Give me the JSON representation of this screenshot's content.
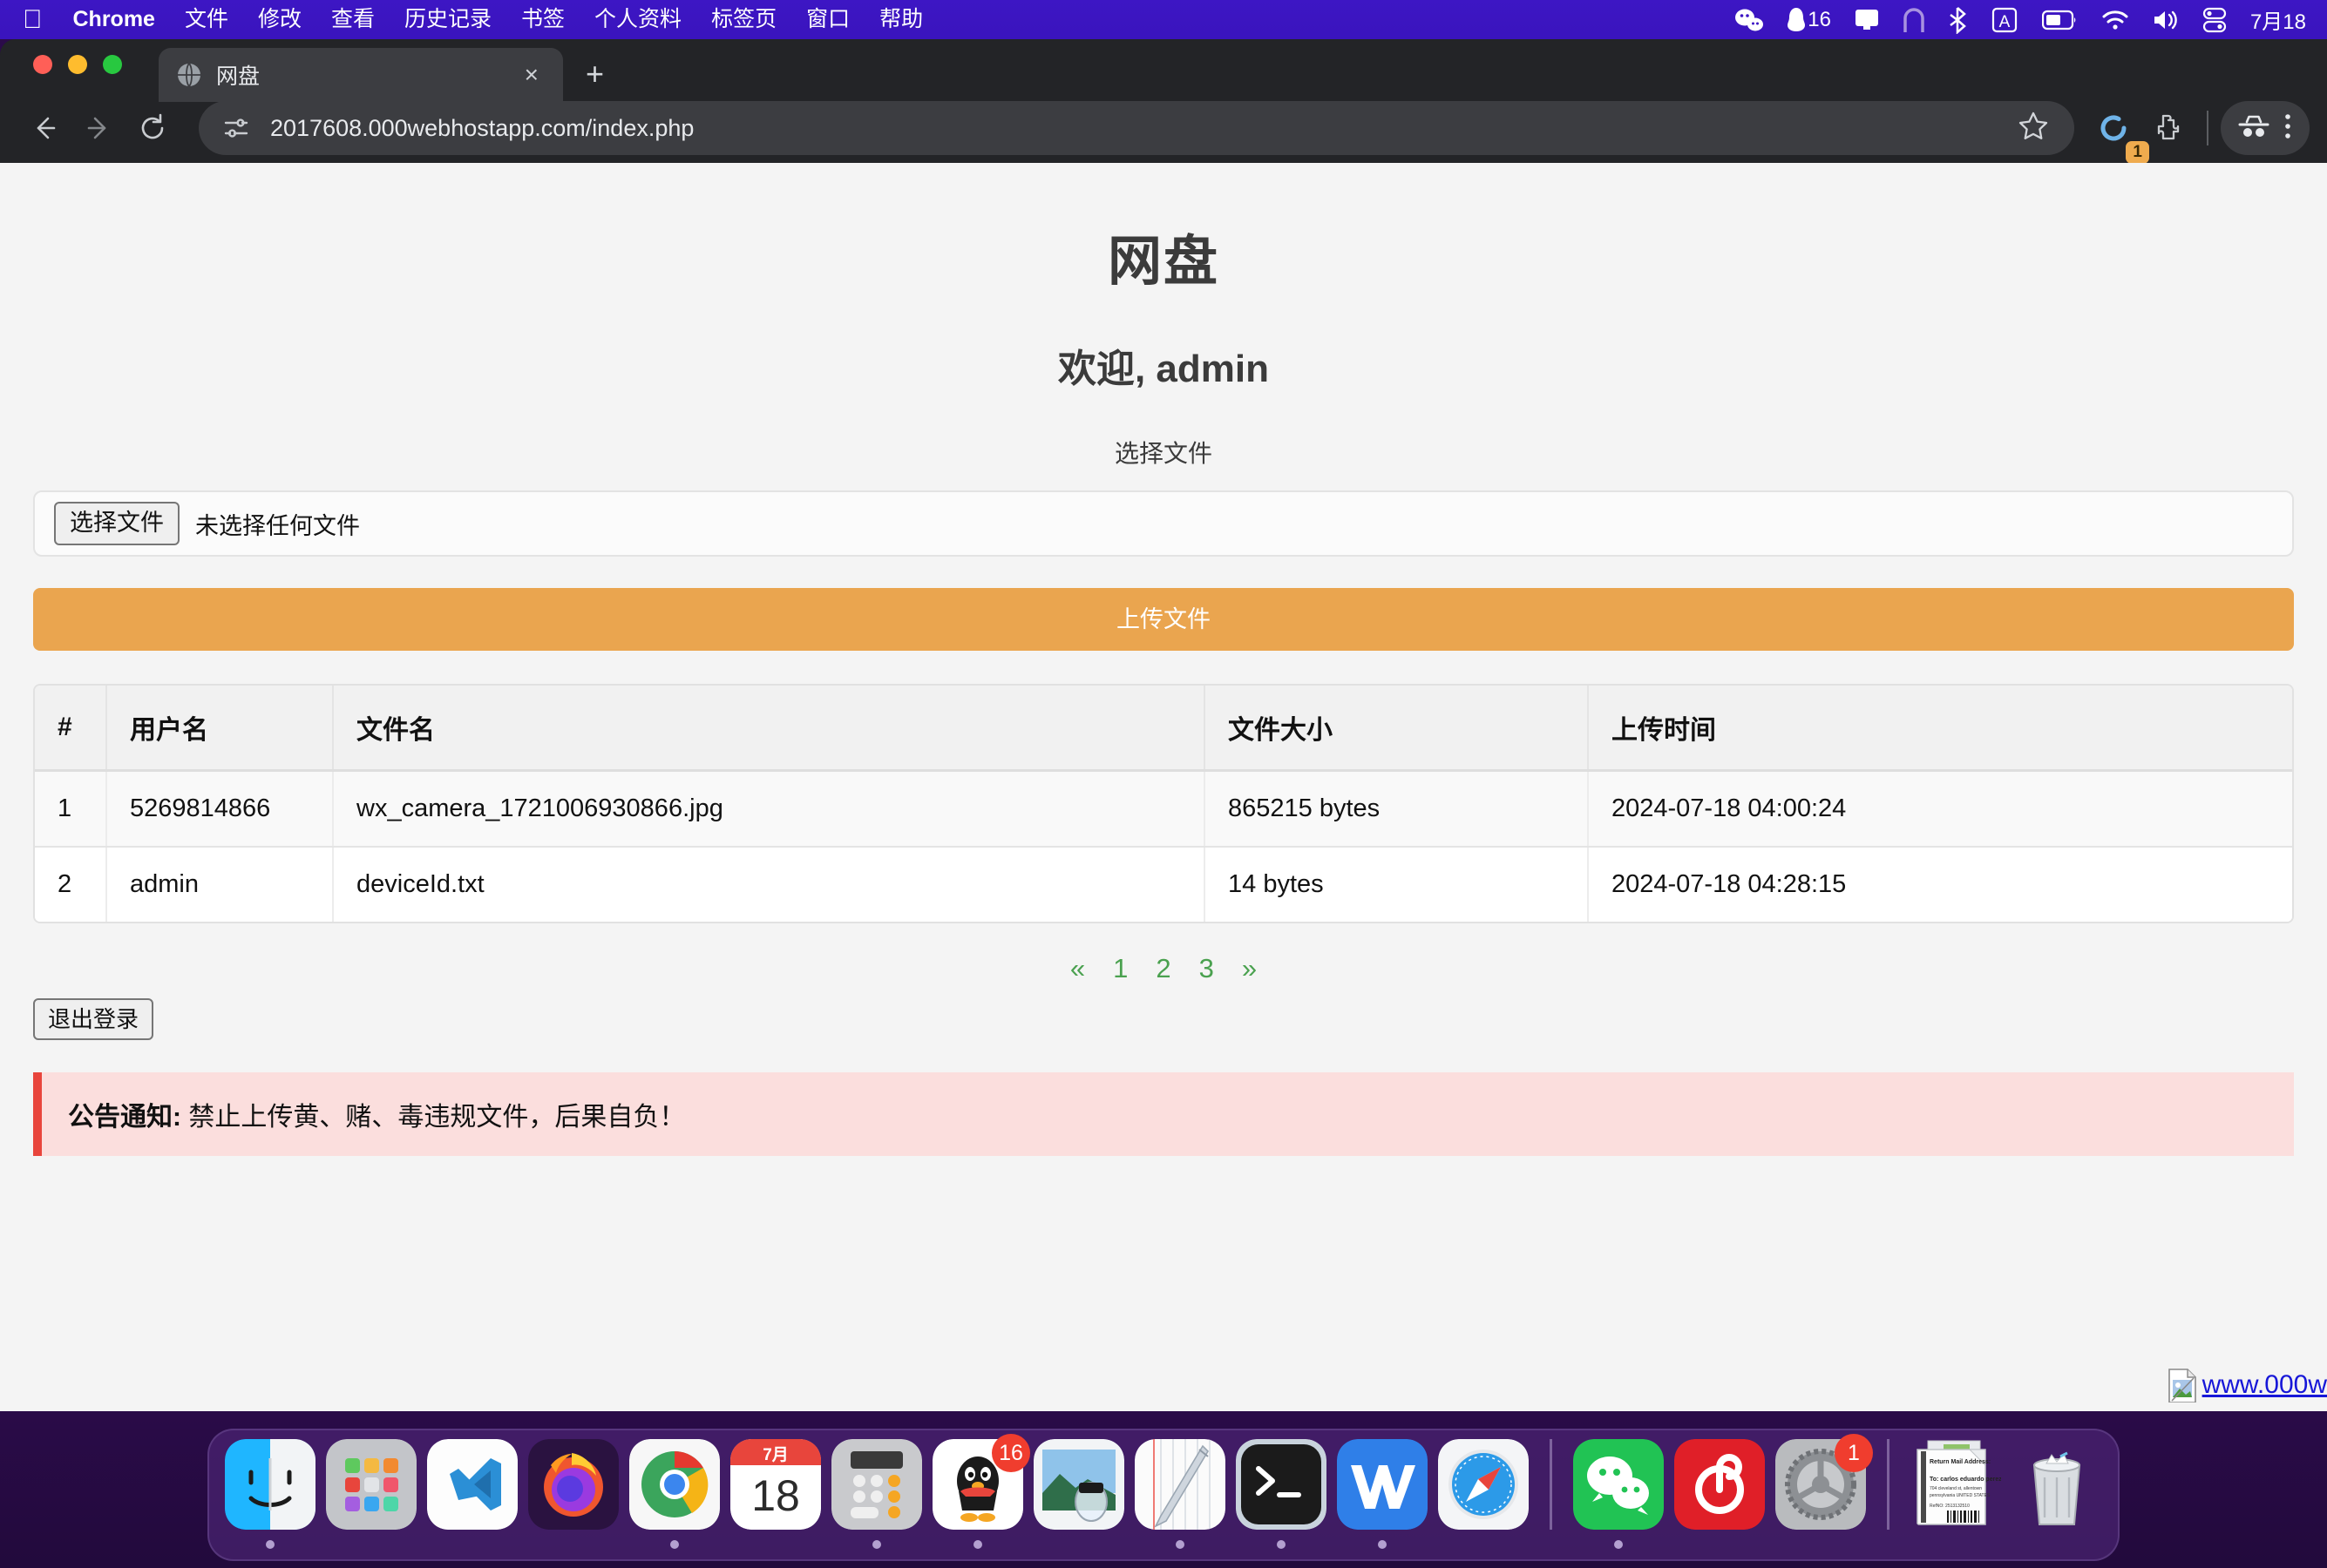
{
  "menubar": {
    "apple_icon": "apple-logo-icon",
    "items": [
      {
        "label": "Chrome",
        "bold": true
      },
      {
        "label": "文件",
        "bold": false
      },
      {
        "label": "修改",
        "bold": false
      },
      {
        "label": "查看",
        "bold": false
      },
      {
        "label": "历史记录",
        "bold": false
      },
      {
        "label": "书签",
        "bold": false
      },
      {
        "label": "个人资料",
        "bold": false
      },
      {
        "label": "标签页",
        "bold": false
      },
      {
        "label": "窗口",
        "bold": false
      },
      {
        "label": "帮助",
        "bold": false
      }
    ],
    "status": {
      "wechat_icon": "wechat-icon",
      "qq_icon": "qq-icon",
      "qq_count": "16",
      "display_icon": "display-icon",
      "arc_icon": "arc-icon",
      "bluetooth_icon": "bluetooth-icon",
      "input_method": "A",
      "battery_icon": "battery-icon",
      "wifi_icon": "wifi-icon",
      "volume_icon": "volume-icon",
      "control_center_icon": "control-center-icon",
      "date": "7月18"
    }
  },
  "browser": {
    "tab": {
      "favicon": "globe-icon",
      "title": "网盘",
      "close": "×"
    },
    "new_tab": "+",
    "toolbar": {
      "back_icon": "back-arrow-icon",
      "forward_icon": "forward-arrow-icon",
      "reload_icon": "reload-icon",
      "site_info_icon": "site-settings-icon",
      "url": "2017608.000webhostapp.com/index.php",
      "bookmark_icon": "star-icon",
      "sync_icon": "sync-circle-icon",
      "sync_badge": "1",
      "extensions_icon": "puzzle-icon",
      "incognito_icon": "incognito-icon",
      "menu_icon": "more-menu-icon"
    }
  },
  "page": {
    "title": "网盘",
    "welcome": "欢迎, admin",
    "pick_label": "选择文件",
    "file_input": {
      "button": "选择文件",
      "status": "未选择任何文件"
    },
    "upload_button": "上传文件",
    "table": {
      "headers": [
        "#",
        "用户名",
        "文件名",
        "文件大小",
        "上传时间"
      ],
      "rows": [
        {
          "index": "1",
          "user": "5269814866",
          "filename": "wx_camera_1721006930866.jpg",
          "size": "865215 bytes",
          "time": "2024-07-18 04:00:24"
        },
        {
          "index": "2",
          "user": "admin",
          "filename": "deviceId.txt",
          "size": "14 bytes",
          "time": "2024-07-18 04:28:15"
        }
      ]
    },
    "pagination": {
      "prev": "«",
      "pages": [
        "1",
        "2",
        "3"
      ],
      "next": "»"
    },
    "logout_button": "退出登录",
    "notice": {
      "label": "公告通知:",
      "text": " 禁止上传黄、赌、毒违规文件，后果自负！"
    },
    "watermark": {
      "broken_image_icon": "broken-image-icon",
      "link": "www.000w"
    },
    "colors": {
      "upload_button": "#eaa54f",
      "pagination_link": "#4aa14f",
      "notice_bg": "#fbdedd",
      "notice_border": "#e8453c"
    }
  },
  "dock": {
    "items": [
      {
        "name": "finder",
        "running": true,
        "badge": ""
      },
      {
        "name": "launchpad",
        "running": false,
        "badge": ""
      },
      {
        "name": "vscode",
        "running": false,
        "badge": ""
      },
      {
        "name": "firefox",
        "running": false,
        "badge": ""
      },
      {
        "name": "chrome",
        "running": true,
        "badge": ""
      },
      {
        "name": "calendar",
        "running": false,
        "badge": "",
        "month": "7月",
        "day": "18"
      },
      {
        "name": "calculator",
        "running": true,
        "badge": ""
      },
      {
        "name": "qq",
        "running": true,
        "badge": "16"
      },
      {
        "name": "preview",
        "running": false,
        "badge": ""
      },
      {
        "name": "notes",
        "running": true,
        "badge": ""
      },
      {
        "name": "terminal",
        "running": true,
        "badge": ""
      },
      {
        "name": "wps",
        "running": true,
        "badge": ""
      },
      {
        "name": "safari",
        "running": false,
        "badge": ""
      },
      {
        "name": "wechat",
        "running": true,
        "badge": ""
      },
      {
        "name": "netease-music",
        "running": false,
        "badge": ""
      },
      {
        "name": "system-settings",
        "running": false,
        "badge": "1"
      },
      {
        "name": "documents-stack",
        "running": false,
        "badge": ""
      },
      {
        "name": "trash",
        "running": false,
        "badge": ""
      }
    ]
  }
}
